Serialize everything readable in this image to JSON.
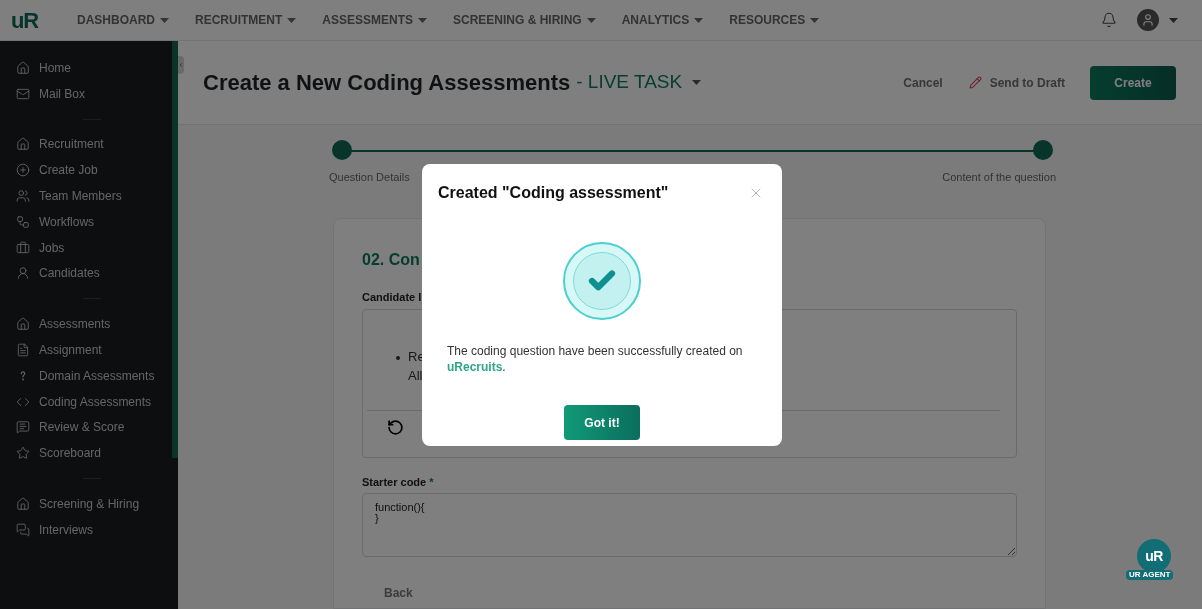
{
  "header": {
    "logo": "uR",
    "nav": [
      {
        "label": "DASHBOARD"
      },
      {
        "label": "RECRUITMENT"
      },
      {
        "label": "ASSESSMENTS"
      },
      {
        "label": "SCREENING & HIRING"
      },
      {
        "label": "ANALYTICS"
      },
      {
        "label": "RESOURCES"
      }
    ]
  },
  "sidebar": {
    "groups": [
      {
        "items": [
          {
            "label": "Home"
          },
          {
            "label": "Mail Box"
          }
        ]
      },
      {
        "items": [
          {
            "label": "Recruitment"
          },
          {
            "label": "Create Job"
          },
          {
            "label": "Team Members"
          },
          {
            "label": "Workflows"
          },
          {
            "label": "Jobs"
          },
          {
            "label": "Candidates"
          }
        ]
      },
      {
        "items": [
          {
            "label": "Assessments"
          },
          {
            "label": "Assignment"
          },
          {
            "label": "Domain Assessments"
          },
          {
            "label": "Coding Assessments"
          },
          {
            "label": "Review & Score"
          },
          {
            "label": "Scoreboard"
          }
        ]
      },
      {
        "items": [
          {
            "label": "Screening & Hiring"
          },
          {
            "label": "Interviews"
          }
        ]
      }
    ]
  },
  "page": {
    "title": "Create a New Coding Assessments",
    "task_type": "- LIVE TASK",
    "actions": {
      "cancel": "Cancel",
      "draft": "Send to Draft",
      "create": "Create"
    }
  },
  "stepper": {
    "steps": [
      {
        "label": "Question Details"
      },
      {
        "label": "Content of the question"
      }
    ]
  },
  "form": {
    "section_title": "02. Con",
    "description_label": "Candidate I",
    "editor_lines": [
      "Re",
      "All"
    ],
    "starter_label": "Starter code",
    "required_mark": "*",
    "starter_code": "function(){\n}",
    "back": "Back"
  },
  "modal": {
    "title": "Created \"Coding assessment\"",
    "message": "The coding question have been successfully created on **uRecruits**.",
    "button": "Got it!"
  },
  "agent": {
    "logo": "uR",
    "caption": "UR AGENT"
  }
}
